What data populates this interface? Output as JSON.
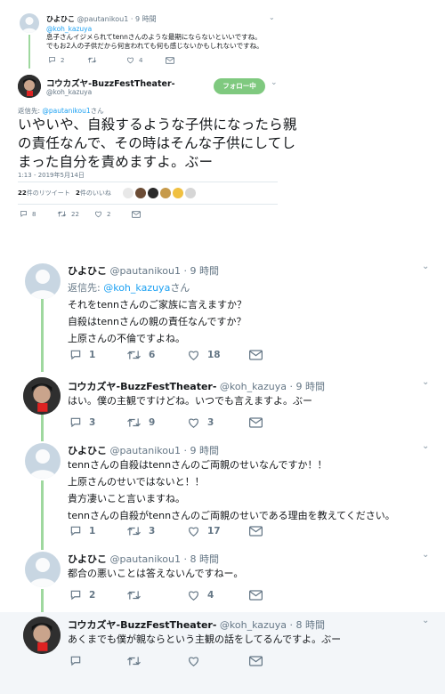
{
  "top": {
    "tweet1": {
      "name": "ひよひこ",
      "handle": "@pautanikou1",
      "time": "· 9 時間",
      "reply_to": "@koh_kazuya",
      "line1": "息子さんイジメられてtennさんのような最期にならないといいですね。",
      "line2": "でもお2人の子供だから何言われても何も感じないかもしれないですね。",
      "replies": "2",
      "retweets": "",
      "likes": "4"
    },
    "main": {
      "name": "コウカズヤ-BuzzFestTheater-",
      "handle": "@koh_kazuya",
      "follow_label": "フォロー中",
      "reply_label": "返信先:",
      "reply_handle": "@pautanikou1",
      "reply_suffix": "さん",
      "body_line1": "いやいや、自殺するような子供になったら親",
      "body_line2": "の責任なんで、その時はそんな子供にしてし",
      "body_line3": "まった自分を責めますよ。ぶー",
      "timestamp": "1:13 - 2019年5月14日",
      "retweet_count": "22",
      "retweet_label": "件のリツイート",
      "like_count": "2",
      "like_label": "件のいいね",
      "replies": "8",
      "retweets": "22",
      "likes": "2"
    }
  },
  "thread": [
    {
      "name": "ひよひこ",
      "handle": "@pautanikou1",
      "time": "· 9 時間",
      "reply_label": "返信先:",
      "reply_handle": "@koh_kazuya",
      "reply_suffix": "さん",
      "lines": [
        "それをtennさんのご家族に言えますか？",
        "自殺はtennさんの親の責任なんですか？",
        "上原さんの不倫ですよね。"
      ],
      "replies": "1",
      "retweets": "6",
      "likes": "18"
    },
    {
      "name": "コウカズヤ-BuzzFestTheater-",
      "handle": "@koh_kazuya",
      "time": "· 9 時間",
      "lines": [
        "はい。僕の主観ですけどね。いつでも言えますよ。ぶー"
      ],
      "replies": "3",
      "retweets": "9",
      "likes": "3"
    },
    {
      "name": "ひよひこ",
      "handle": "@pautanikou1",
      "time": "· 9 時間",
      "lines": [
        "tennさんの自殺はtennさんのご両親のせいなんですか！！",
        "上原さんのせいではないと！！",
        "貴方凄いこと言いますね。",
        "tennさんの自殺がtennさんのご両親のせいである理由を教えてください。"
      ],
      "replies": "1",
      "retweets": "3",
      "likes": "17"
    },
    {
      "name": "ひよひこ",
      "handle": "@pautanikou1",
      "time": "· 8 時間",
      "lines": [
        "都合の悪いことは答えないんですねー。"
      ],
      "replies": "2",
      "retweets": "",
      "likes": "4"
    },
    {
      "name": "コウカズヤ-BuzzFestTheater-",
      "handle": "@koh_kazuya",
      "time": "· 8 時間",
      "lines": [
        "あくまでも僕が親ならという主観の話をしてるんですよ。ぶー"
      ],
      "replies": "",
      "retweets": "",
      "likes": ""
    }
  ],
  "colors": {
    "accent": "#1da1f2",
    "follow_button": "#7fc97f",
    "thread_line": "#9fd89f",
    "muted": "#657786",
    "highlight_bg": "#f3f6f9"
  },
  "icons": [
    "reply-icon",
    "retweet-icon",
    "like-icon",
    "dm-icon",
    "chevron-down-icon",
    "default-avatar-icon"
  ]
}
